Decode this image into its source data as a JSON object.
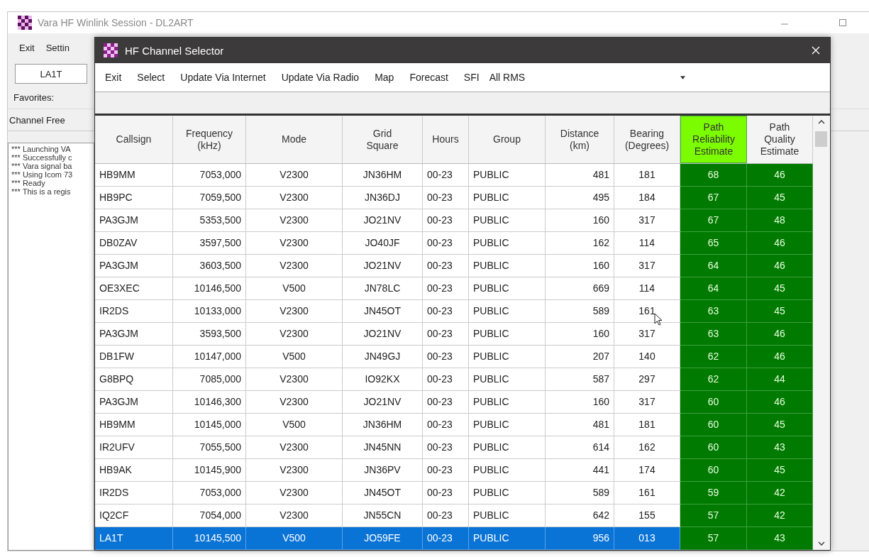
{
  "main_window": {
    "title": "Vara HF Winlink Session - DL2ART",
    "menu": [
      "Exit",
      "Settin"
    ],
    "callsign_field": "LA1T",
    "favorites_label": "Favorites:",
    "channel_label": "Channel Free",
    "log": [
      "*** Launching VA",
      "*** Successfully c",
      "*** Vara signal ba",
      "*** Using Icom 73",
      "*** Ready",
      "*** This is a regis"
    ]
  },
  "dialog": {
    "title": "HF Channel Selector",
    "menu": [
      "Exit",
      "Select",
      "Update Via Internet",
      "Update Via Radio",
      "Map",
      "Forecast",
      "SFI"
    ],
    "dropdown": {
      "value": "All RMS"
    },
    "table": {
      "columns": [
        {
          "lines": [
            "Callsign"
          ],
          "kind": "text",
          "highlighted": false
        },
        {
          "lines": [
            "Frequency",
            "(kHz)"
          ],
          "kind": "number",
          "highlighted": false
        },
        {
          "lines": [
            "Mode"
          ],
          "kind": "center",
          "highlighted": false
        },
        {
          "lines": [
            "Grid",
            "Square"
          ],
          "kind": "center",
          "highlighted": false
        },
        {
          "lines": [
            "Hours"
          ],
          "kind": "text",
          "highlighted": false
        },
        {
          "lines": [
            "Group"
          ],
          "kind": "text",
          "highlighted": false
        },
        {
          "lines": [
            "Distance",
            "(km)"
          ],
          "kind": "number",
          "highlighted": false
        },
        {
          "lines": [
            "Bearing",
            "(Degrees)"
          ],
          "kind": "center",
          "highlighted": false
        },
        {
          "lines": [
            "Path",
            "Reliability",
            "Estimate"
          ],
          "kind": "estimate",
          "highlighted": true
        },
        {
          "lines": [
            "Path",
            "Quality",
            "Estimate"
          ],
          "kind": "estimate",
          "highlighted": false
        }
      ],
      "rows": [
        {
          "cells": [
            "HB9MM",
            "7053,000",
            "V2300",
            "JN36HM",
            "00-23",
            "PUBLIC",
            "481",
            "181",
            "68",
            "46"
          ],
          "selected": false
        },
        {
          "cells": [
            "HB9PC",
            "7059,500",
            "V2300",
            "JN36DJ",
            "00-23",
            "PUBLIC",
            "495",
            "184",
            "67",
            "45"
          ],
          "selected": false
        },
        {
          "cells": [
            "PA3GJM",
            "5353,500",
            "V2300",
            "JO21NV",
            "00-23",
            "PUBLIC",
            "160",
            "317",
            "67",
            "48"
          ],
          "selected": false
        },
        {
          "cells": [
            "DB0ZAV",
            "3597,500",
            "V2300",
            "JO40JF",
            "00-23",
            "PUBLIC",
            "162",
            "114",
            "65",
            "46"
          ],
          "selected": false
        },
        {
          "cells": [
            "PA3GJM",
            "3603,500",
            "V2300",
            "JO21NV",
            "00-23",
            "PUBLIC",
            "160",
            "317",
            "64",
            "46"
          ],
          "selected": false
        },
        {
          "cells": [
            "OE3XEC",
            "10146,500",
            "V500",
            "JN78LC",
            "00-23",
            "PUBLIC",
            "669",
            "114",
            "64",
            "45"
          ],
          "selected": false
        },
        {
          "cells": [
            "IR2DS",
            "10133,000",
            "V2300",
            "JN45OT",
            "00-23",
            "PUBLIC",
            "589",
            "161",
            "63",
            "45"
          ],
          "selected": false
        },
        {
          "cells": [
            "PA3GJM",
            "3593,500",
            "V2300",
            "JO21NV",
            "00-23",
            "PUBLIC",
            "160",
            "317",
            "63",
            "46"
          ],
          "selected": false
        },
        {
          "cells": [
            "DB1FW",
            "10147,000",
            "V500",
            "JN49GJ",
            "00-23",
            "PUBLIC",
            "207",
            "140",
            "62",
            "46"
          ],
          "selected": false
        },
        {
          "cells": [
            "G8BPQ",
            "7085,000",
            "V2300",
            "IO92KX",
            "00-23",
            "PUBLIC",
            "587",
            "297",
            "62",
            "44"
          ],
          "selected": false
        },
        {
          "cells": [
            "PA3GJM",
            "10146,300",
            "V2300",
            "JO21NV",
            "00-23",
            "PUBLIC",
            "160",
            "317",
            "60",
            "46"
          ],
          "selected": false
        },
        {
          "cells": [
            "HB9MM",
            "10145,000",
            "V500",
            "JN36HM",
            "00-23",
            "PUBLIC",
            "481",
            "181",
            "60",
            "45"
          ],
          "selected": false
        },
        {
          "cells": [
            "IR2UFV",
            "7055,500",
            "V2300",
            "JN45NN",
            "00-23",
            "PUBLIC",
            "614",
            "162",
            "60",
            "43"
          ],
          "selected": false
        },
        {
          "cells": [
            "HB9AK",
            "10145,900",
            "V2300",
            "JN36PV",
            "00-23",
            "PUBLIC",
            "441",
            "174",
            "60",
            "45"
          ],
          "selected": false
        },
        {
          "cells": [
            "IR2DS",
            "7053,000",
            "V2300",
            "JN45OT",
            "00-23",
            "PUBLIC",
            "589",
            "161",
            "59",
            "42"
          ],
          "selected": false
        },
        {
          "cells": [
            "IQ2CF",
            "7054,000",
            "V2300",
            "JN55CN",
            "00-23",
            "PUBLIC",
            "642",
            "155",
            "57",
            "42"
          ],
          "selected": false
        },
        {
          "cells": [
            "LA1T",
            "10145,500",
            "V500",
            "JO59FE",
            "00-23",
            "PUBLIC",
            "956",
            "013",
            "57",
            "43"
          ],
          "selected": true
        }
      ]
    }
  }
}
